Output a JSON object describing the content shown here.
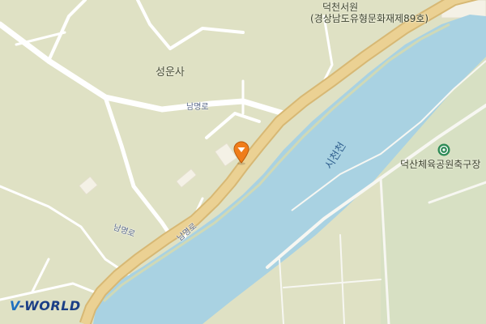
{
  "map": {
    "provider_logo": {
      "v": "V",
      "rest": "-WORLD"
    },
    "labels": {
      "seowon_name": "덕천서원",
      "seowon_note": "(경상남도유형문화재제89호)",
      "temple": "성운사",
      "road_1": "남명로",
      "road_2": "남명로",
      "road_3": "남명로",
      "river": "시천천",
      "sports_park": "덕산체육공원축구장"
    },
    "marker": {
      "icon": "location-pin-icon",
      "color": "#f07d1a"
    },
    "sports_icon": {
      "icon": "soccer-ball-icon",
      "color": "#2e8b57"
    },
    "colors": {
      "land": "#dfe1c4",
      "river": "#a9d2e2",
      "main_road": "#e9cc88",
      "local_road": "#ffffff",
      "park": "#cfe0c2"
    }
  }
}
